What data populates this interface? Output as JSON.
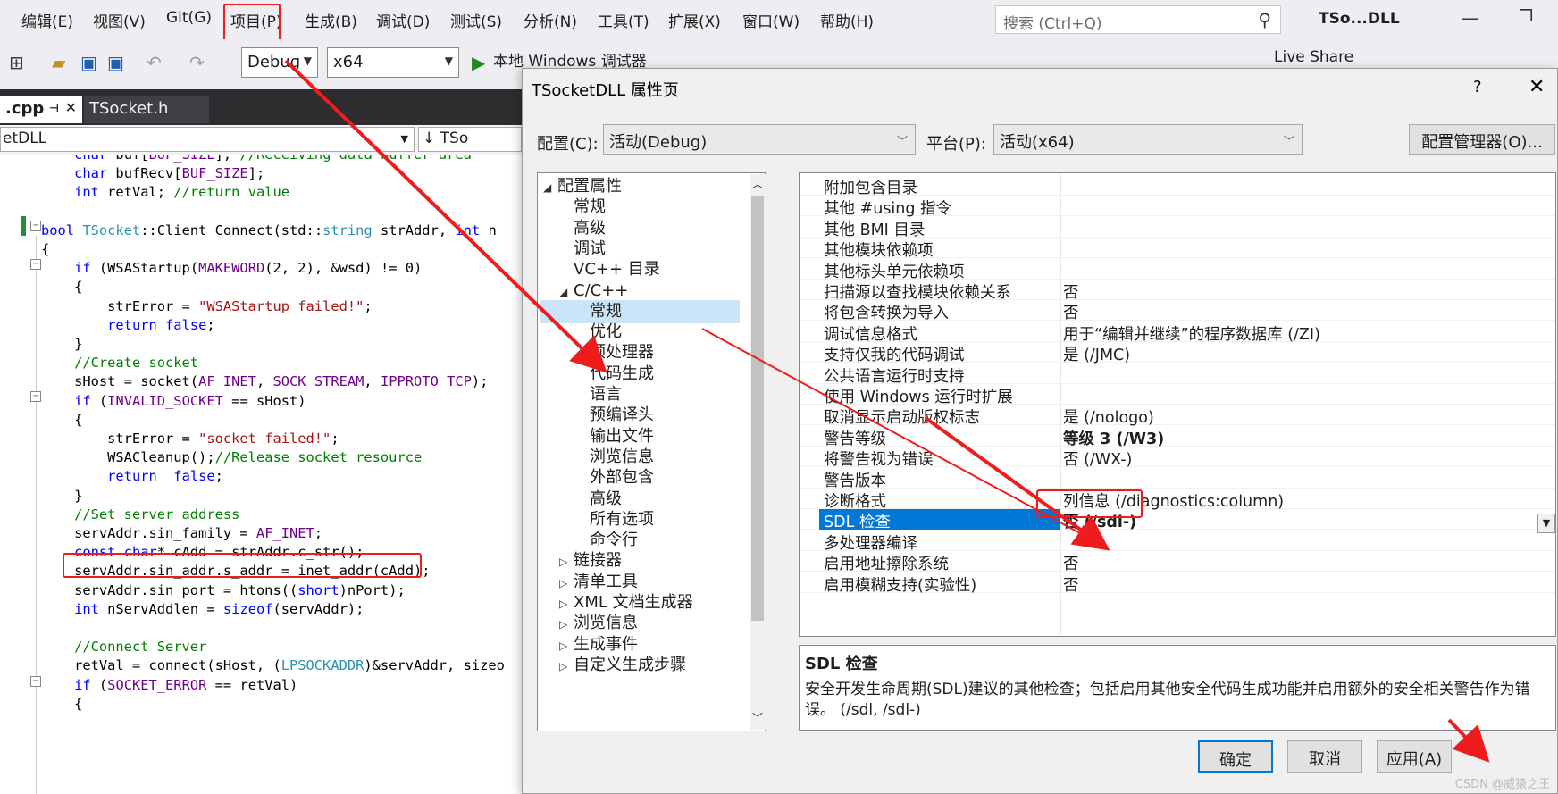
{
  "menu": {
    "items": [
      "编辑(E)",
      "视图(V)",
      "Git(G)",
      "项目(P)",
      "生成(B)",
      "调试(D)",
      "测试(S)",
      "分析(N)",
      "工具(T)",
      "扩展(X)",
      "窗口(W)",
      "帮助(H)"
    ],
    "search_placeholder": "搜索 (Ctrl+Q)",
    "window_title": "TSo...DLL"
  },
  "toolbar": {
    "config": "Debug",
    "platform": "x64",
    "run_label": "本地 Windows 调试器",
    "live_share": "Live Share"
  },
  "editor": {
    "tabs": [
      ".cpp",
      "TSocket.h"
    ],
    "nav_scope": "etDLL",
    "nav_member": "TSo",
    "code_lines": [
      "    char buf[BUF_SIZE]; //Receiving data buffer area",
      "    char bufRecv[BUF_SIZE];",
      "    int retVal; //return value",
      "",
      "bool TSocket::Client_Connect(std::string strAddr, int n",
      "{",
      "    if (WSAStartup(MAKEWORD(2, 2), &wsd) != 0)",
      "    {",
      "        strError = \"WSAStartup failed!\";",
      "        return false;",
      "    }",
      "    //Create socket",
      "    sHost = socket(AF_INET, SOCK_STREAM, IPPROTO_TCP);",
      "    if (INVALID_SOCKET == sHost)",
      "    {",
      "        strError = \"socket failed!\";",
      "        WSACleanup();//Release socket resource",
      "        return  false;",
      "    }",
      "    //Set server address",
      "    servAddr.sin_family = AF_INET;",
      "    const char* cAdd = strAddr.c_str();",
      "    servAddr.sin_addr.s_addr = inet_addr(cAdd);",
      "    servAddr.sin_port = htons((short)nPort);",
      "    int nServAddlen = sizeof(servAddr);",
      "",
      "    //Connect Server",
      "    retVal = connect(sHost, (LPSOCKADDR)&servAddr, sizeo",
      "    if (SOCKET_ERROR == retVal)",
      "    {"
    ]
  },
  "dialog": {
    "title": "TSocketDLL 属性页",
    "help": "?",
    "close": "✕",
    "config_label": "配置(C):",
    "config_value": "活动(Debug)",
    "platform_label": "平台(P):",
    "platform_value": "活动(x64)",
    "config_manager": "配置管理器(O)...",
    "tree": [
      {
        "label": "配置属性",
        "level": 0,
        "arrow": "▲"
      },
      {
        "label": "常规",
        "level": 1
      },
      {
        "label": "高级",
        "level": 1
      },
      {
        "label": "调试",
        "level": 1
      },
      {
        "label": "VC++ 目录",
        "level": 1
      },
      {
        "label": "C/C++",
        "level": 1,
        "arrow": "▲"
      },
      {
        "label": "常规",
        "level": 2,
        "selected": true
      },
      {
        "label": "优化",
        "level": 2
      },
      {
        "label": "预处理器",
        "level": 2
      },
      {
        "label": "代码生成",
        "level": 2
      },
      {
        "label": "语言",
        "level": 2
      },
      {
        "label": "预编译头",
        "level": 2
      },
      {
        "label": "输出文件",
        "level": 2
      },
      {
        "label": "浏览信息",
        "level": 2
      },
      {
        "label": "外部包含",
        "level": 2
      },
      {
        "label": "高级",
        "level": 2
      },
      {
        "label": "所有选项",
        "level": 2
      },
      {
        "label": "命令行",
        "level": 2
      },
      {
        "label": "链接器",
        "level": 1,
        "arrow": "▷"
      },
      {
        "label": "清单工具",
        "level": 1,
        "arrow": "▷"
      },
      {
        "label": "XML 文档生成器",
        "level": 1,
        "arrow": "▷"
      },
      {
        "label": "浏览信息",
        "level": 1,
        "arrow": "▷"
      },
      {
        "label": "生成事件",
        "level": 1,
        "arrow": "▷"
      },
      {
        "label": "自定义生成步骤",
        "level": 1,
        "arrow": "▷"
      }
    ],
    "properties": [
      {
        "name": "附加包含目录",
        "value": ""
      },
      {
        "name": "其他 #using 指令",
        "value": ""
      },
      {
        "name": "其他 BMI 目录",
        "value": ""
      },
      {
        "name": "其他模块依赖项",
        "value": ""
      },
      {
        "name": "其他标头单元依赖项",
        "value": ""
      },
      {
        "name": "扫描源以查找模块依赖关系",
        "value": "否"
      },
      {
        "name": "将包含转换为导入",
        "value": "否"
      },
      {
        "name": "调试信息格式",
        "value": "用于“编辑并继续”的程序数据库 (/ZI)"
      },
      {
        "name": "支持仅我的代码调试",
        "value": "是 (/JMC)"
      },
      {
        "name": "公共语言运行时支持",
        "value": ""
      },
      {
        "name": "使用 Windows 运行时扩展",
        "value": ""
      },
      {
        "name": "取消显示启动版权标志",
        "value": "是 (/nologo)"
      },
      {
        "name": "警告等级",
        "value": "等级 3 (/W3)",
        "bold": true
      },
      {
        "name": "将警告视为错误",
        "value": "否 (/WX-)"
      },
      {
        "name": "警告版本",
        "value": ""
      },
      {
        "name": "诊断格式",
        "value": "列信息 (/diagnostics:column)"
      },
      {
        "name": "SDL 检查",
        "value": "否 (/sdl-)",
        "bold": true,
        "selected": true
      },
      {
        "name": "多处理器编译",
        "value": ""
      },
      {
        "name": "启用地址擦除系统",
        "value": "否"
      },
      {
        "name": "启用模糊支持(实验性)",
        "value": "否"
      }
    ],
    "desc_title": "SDL 检查",
    "desc_text": "安全开发生命周期(SDL)建议的其他检查；包括启用其他安全代码生成功能并启用额外的安全相关警告作为错误。    (/sdl, /sdl-)",
    "ok": "确定",
    "cancel": "取消",
    "apply": "应用(A)"
  },
  "watermark": "CSDN @威猿之王",
  "colors": {
    "selection": "#0078d7",
    "annotation": "#ee1c1c",
    "tab_active": "#0e639c"
  }
}
